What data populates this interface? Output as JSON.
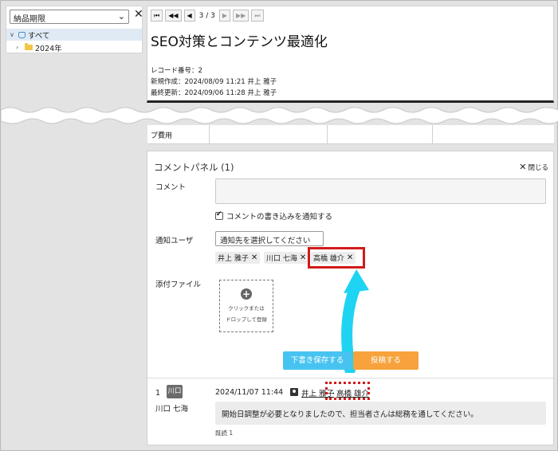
{
  "sidebar": {
    "filter_value": "納品期限",
    "close_glyph": "✕",
    "tree": [
      {
        "label": "すべて",
        "toggle": "∨"
      },
      {
        "label": "2024年",
        "toggle": "›"
      }
    ]
  },
  "record": {
    "pager": {
      "first": "⏮",
      "prev_fast": "◀◀",
      "prev": "◀",
      "position": "3 / 3",
      "next": "▶",
      "next_fast": "▶▶",
      "last": "⏭"
    },
    "title": "SEO対策とコンテンツ最適化",
    "record_no": "レコード番号：2",
    "created": "新規作成：2024/08/09 11:21 井上 雅子",
    "updated": "最終更新：2024/09/06 11:28 井上 雅子"
  },
  "table_strip": {
    "cell_label": "プ費用"
  },
  "comment_panel": {
    "title": "コメントパネル (1)",
    "close_label": "閉じる",
    "comment_label": "コメント",
    "notify_checkbox_label": "コメントの書き込みを通知する",
    "notify_users_label": "通知ユーザ",
    "user_select_placeholder": "通知先を選択してください",
    "chips": [
      {
        "label": "井上 雅子"
      },
      {
        "label": "川口 七海"
      },
      {
        "label": "高橋 雄介"
      }
    ],
    "attachment_label": "添付ファイル",
    "upload_line1": "クリックまたは",
    "upload_line2": "ドロップして登録",
    "draft_button": "下書き保存する",
    "post_button": "投稿する"
  },
  "comment": {
    "number": "1",
    "avatar_text": "川口",
    "author": "川口 七海",
    "datetime": "2024/11/07 11:44",
    "mentions": [
      "井上 雅子",
      "高橋 雄介"
    ],
    "mention_sep": ",",
    "body": "開始日調整が必要となりましたので、担当者さんは総務を通してください。",
    "read_label": "既読 1"
  },
  "colors": {
    "accent_blue": "#47c3f1",
    "accent_orange": "#f7a23c",
    "highlight_red": "#d11a1a",
    "arrow_cyan": "#1fd3f2"
  }
}
